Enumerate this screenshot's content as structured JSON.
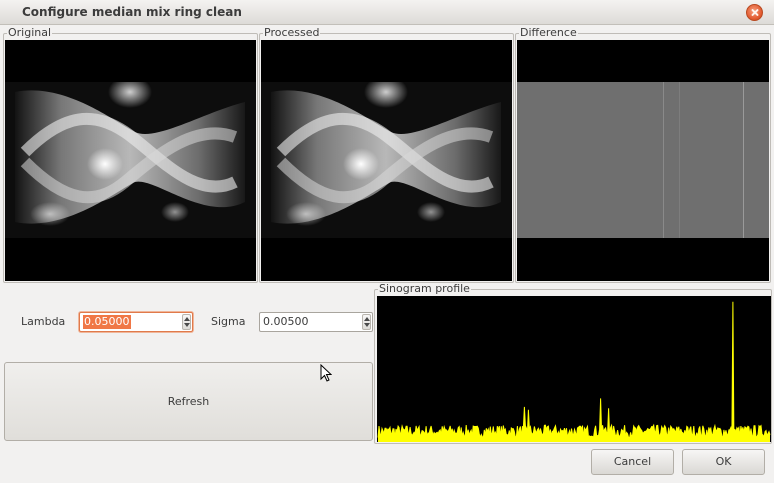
{
  "window": {
    "title": "Configure median mix ring clean",
    "close_icon": "close-icon"
  },
  "panels": {
    "original": {
      "label": "Original"
    },
    "processed": {
      "label": "Processed"
    },
    "difference": {
      "label": "Difference"
    },
    "profile": {
      "label": "Sinogram profile"
    }
  },
  "params": {
    "lambda": {
      "label": "Lambda",
      "value": "0.05000"
    },
    "sigma": {
      "label": "Sigma",
      "value": "0.00500"
    }
  },
  "buttons": {
    "refresh": "Refresh",
    "cancel": "Cancel",
    "ok": "OK"
  },
  "colors": {
    "profile_line": "#ffff00",
    "focus_accent": "#f07746"
  },
  "chart_data": {
    "type": "line",
    "title": "Sinogram profile",
    "xlabel": "",
    "ylabel": "",
    "x_count": 392,
    "ylim": [
      0,
      1
    ],
    "series": [
      {
        "values_description_free": true,
        "peaks": [
          {
            "x": 146,
            "y": 0.24
          },
          {
            "x": 150,
            "y": 0.22
          },
          {
            "x": 222,
            "y": 0.3
          },
          {
            "x": 230,
            "y": 0.23
          },
          {
            "x": 354,
            "y": 0.98
          }
        ],
        "baseline": 0.08
      }
    ]
  }
}
